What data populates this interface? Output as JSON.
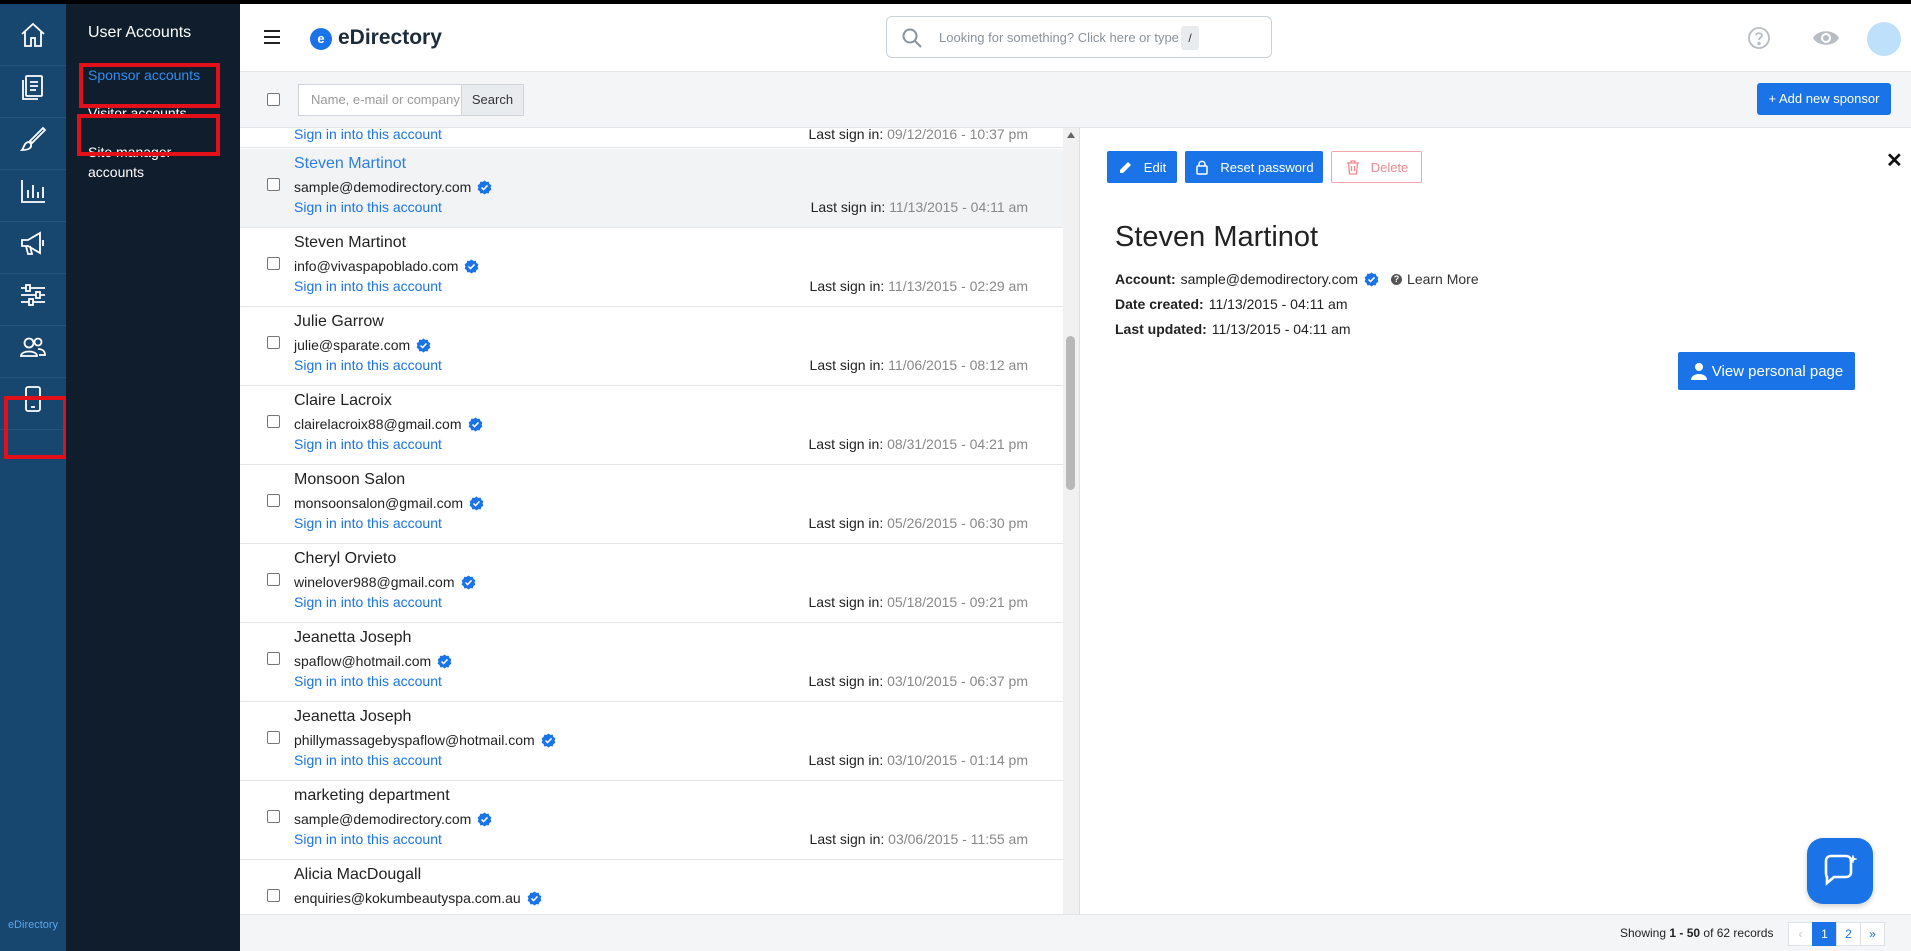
{
  "rail": {
    "items": [
      "home-icon",
      "documents-icon",
      "brush-icon",
      "chart-icon",
      "megaphone-icon",
      "sliders-icon",
      "users-icon",
      "mobile-icon"
    ],
    "brand": "eDirectory"
  },
  "subnav": {
    "title": "User Accounts",
    "items": [
      "Sponsor accounts",
      "Visitor accounts",
      "Site manager accounts"
    ]
  },
  "header": {
    "logo": "eDirectory",
    "logo_mark": "e",
    "search_placeholder": "Looking for something? Click here or type",
    "search_key": "/"
  },
  "toolbar": {
    "search_placeholder": "Name, e-mail or company",
    "search_button": "Search",
    "add_button": "+ Add new sponsor"
  },
  "list": {
    "signin_label": "Sign in into this account",
    "lastsign_label": "Last sign in:",
    "partial_lastsign": "09/12/2016 - 10:37 pm",
    "rows": [
      {
        "name": "Steven Martinot",
        "email": "sample@demodirectory.com",
        "last": "11/13/2015 - 04:11 am"
      },
      {
        "name": "Steven Martinot",
        "email": "info@vivaspapoblado.com",
        "last": "11/13/2015 - 02:29 am"
      },
      {
        "name": "Julie Garrow",
        "email": "julie@sparate.com",
        "last": "11/06/2015 - 08:12 am"
      },
      {
        "name": "Claire Lacroix",
        "email": "clairelacroix88@gmail.com",
        "last": "08/31/2015 - 04:21 pm"
      },
      {
        "name": "Monsoon Salon",
        "email": "monsoonsalon@gmail.com",
        "last": "05/26/2015 - 06:30 pm"
      },
      {
        "name": "Cheryl Orvieto",
        "email": "winelover988@gmail.com",
        "last": "05/18/2015 - 09:21 pm"
      },
      {
        "name": "Jeanetta Joseph",
        "email": "spaflow@hotmail.com",
        "last": "03/10/2015 - 06:37 pm"
      },
      {
        "name": "Jeanetta Joseph",
        "email": "phillymassagebyspaflow@hotmail.com",
        "last": "03/10/2015 - 01:14 pm"
      },
      {
        "name": "marketing department",
        "email": "sample@demodirectory.com",
        "last": "03/06/2015 - 11:55 am"
      },
      {
        "name": "Alicia MacDougall",
        "email": "enquiries@kokumbeautyspa.com.au",
        "last": ""
      }
    ]
  },
  "detail": {
    "edit": "Edit",
    "reset": "Reset password",
    "delete": "Delete",
    "close": "✕",
    "name": "Steven Martinot",
    "account_label": "Account:",
    "account": "sample@demodirectory.com",
    "learn_more": "Learn More",
    "created_label": "Date created:",
    "created": "11/13/2015 - 04:11 am",
    "updated_label": "Last updated:",
    "updated": "11/13/2015 - 04:11 am",
    "view_button": "View personal page"
  },
  "footer": {
    "showing_prefix": "Showing",
    "range": "1 - 50",
    "of_text": "of 62 records",
    "pages": [
      "‹",
      "1",
      "2",
      "»"
    ],
    "active_page": "1"
  },
  "colors": {
    "accent": "#1a74e8",
    "rail_bg": "#17466f",
    "subnav_bg": "#0f1d2c",
    "highlight_red": "#e3101a"
  }
}
